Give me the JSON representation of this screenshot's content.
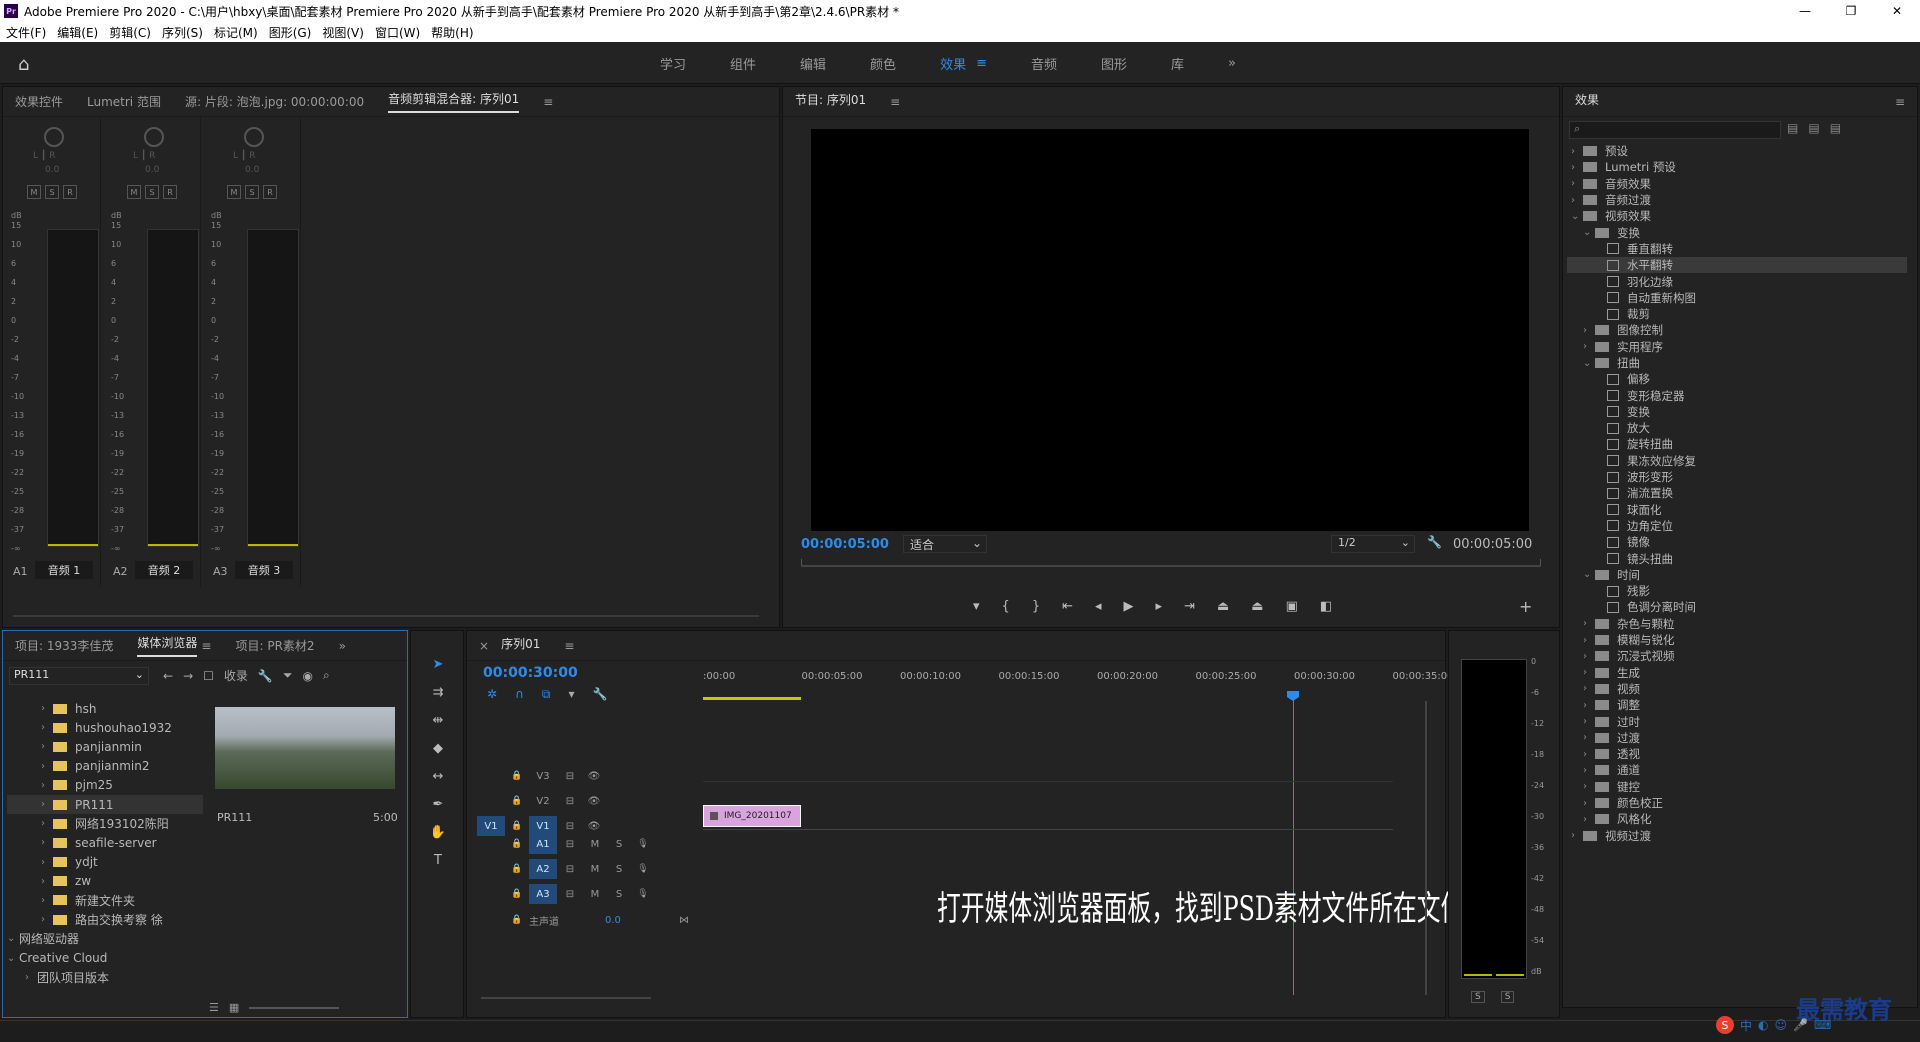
{
  "window": {
    "title": "Adobe Premiere Pro 2020 - C:\\用户\\hbxy\\桌面\\配套素材 Premiere Pro 2020 从新手到高手\\配套素材 Premiere Pro 2020 从新手到高手\\第2章\\2.4.6\\PR素材 *",
    "logo": "Pr"
  },
  "menu": [
    "文件(F)",
    "编辑(E)",
    "剪辑(C)",
    "序列(S)",
    "标记(M)",
    "图形(G)",
    "视图(V)",
    "窗口(W)",
    "帮助(H)"
  ],
  "workspaces": [
    "学习",
    "组件",
    "编辑",
    "颜色",
    "效果",
    "音频",
    "图形",
    "库"
  ],
  "active_workspace": "效果",
  "top_left_tabs": [
    "效果控件",
    "Lumetri 范围",
    "源: 片段: 泡泡.jpg: 00:00:00:00",
    "音频剪辑混合器: 序列01"
  ],
  "mixer": {
    "lr": "L ┃ R",
    "gain": "0.0",
    "db": "dB",
    "scale": [
      "15",
      "10",
      "6",
      "4",
      "2",
      "0",
      "-2",
      "-4",
      "-7",
      "-10",
      "-13",
      "-16",
      "-19",
      "-22",
      "-25",
      "-28",
      "-37",
      "-∞"
    ],
    "channels": [
      {
        "id": "A1",
        "name": "音频 1"
      },
      {
        "id": "A2",
        "name": "音频 2"
      },
      {
        "id": "A3",
        "name": "音频 3"
      }
    ],
    "msr": [
      "M",
      "S",
      "R"
    ]
  },
  "program": {
    "title": "节目: 序列01",
    "timecode": "00:00:05:00",
    "fit": "适合",
    "res": "1/2",
    "duration": "00:00:05:00"
  },
  "project": {
    "tabs": [
      "项目: 1933李佳茂",
      "媒体浏览器",
      "项目: PR素材2"
    ],
    "dropdown": "PR111",
    "ingest": "收录",
    "folders": [
      "hsh",
      "hushouhao1932",
      "panjianmin",
      "panjianmin2",
      "pjm25",
      "PR111",
      "网络193102陈阳",
      "seafile-server",
      "ydjt",
      "zw",
      "新建文件夹",
      "路由交换考察 徐"
    ],
    "network": "网络驱动器",
    "cloud": "Creative Cloud",
    "team": "团队项目版本",
    "clip": {
      "name": "PR111",
      "dur": "5:00"
    }
  },
  "timeline": {
    "title": "序列01",
    "timecode": "00:00:30:00",
    "ruler": [
      ":00:00",
      "00:00:05:00",
      "00:00:10:00",
      "00:00:15:00",
      "00:00:20:00",
      "00:00:25:00",
      "00:00:30:00",
      "00:00:35:00"
    ],
    "vtracks": [
      "V3",
      "V2",
      "V1"
    ],
    "atracks": [
      "A1",
      "A2",
      "A3"
    ],
    "src": "V1",
    "master": "主声道",
    "master_val": "0.0",
    "clip": "IMG_20201107",
    "caption": "打开媒体浏览器面板，找到PSD素材文件所在文件夹"
  },
  "meter_scale": [
    "0",
    "-6",
    "-12",
    "-18",
    "-24",
    "-30",
    "-36",
    "-42",
    "-48",
    "-54",
    "dB"
  ],
  "effects": {
    "title": "效果",
    "items": [
      {
        "t": "预设",
        "l": 0,
        "k": "f",
        "o": false
      },
      {
        "t": "Lumetri 预设",
        "l": 0,
        "k": "f",
        "o": false
      },
      {
        "t": "音频效果",
        "l": 0,
        "k": "f",
        "o": false
      },
      {
        "t": "音频过渡",
        "l": 0,
        "k": "f",
        "o": false
      },
      {
        "t": "视频效果",
        "l": 0,
        "k": "f",
        "o": true
      },
      {
        "t": "变换",
        "l": 1,
        "k": "f",
        "o": true
      },
      {
        "t": "垂直翻转",
        "l": 2,
        "k": "p"
      },
      {
        "t": "水平翻转",
        "l": 2,
        "k": "p",
        "sel": true
      },
      {
        "t": "羽化边缘",
        "l": 2,
        "k": "p"
      },
      {
        "t": "自动重新构图",
        "l": 2,
        "k": "p"
      },
      {
        "t": "裁剪",
        "l": 2,
        "k": "p"
      },
      {
        "t": "图像控制",
        "l": 1,
        "k": "f",
        "o": false
      },
      {
        "t": "实用程序",
        "l": 1,
        "k": "f",
        "o": false
      },
      {
        "t": "扭曲",
        "l": 1,
        "k": "f",
        "o": true
      },
      {
        "t": "偏移",
        "l": 2,
        "k": "p"
      },
      {
        "t": "变形稳定器",
        "l": 2,
        "k": "p"
      },
      {
        "t": "变换",
        "l": 2,
        "k": "p"
      },
      {
        "t": "放大",
        "l": 2,
        "k": "p"
      },
      {
        "t": "旋转扭曲",
        "l": 2,
        "k": "p"
      },
      {
        "t": "果冻效应修复",
        "l": 2,
        "k": "p"
      },
      {
        "t": "波形变形",
        "l": 2,
        "k": "p"
      },
      {
        "t": "湍流置换",
        "l": 2,
        "k": "p"
      },
      {
        "t": "球面化",
        "l": 2,
        "k": "p"
      },
      {
        "t": "边角定位",
        "l": 2,
        "k": "p"
      },
      {
        "t": "镜像",
        "l": 2,
        "k": "p"
      },
      {
        "t": "镜头扭曲",
        "l": 2,
        "k": "p"
      },
      {
        "t": "时间",
        "l": 1,
        "k": "f",
        "o": true
      },
      {
        "t": "残影",
        "l": 2,
        "k": "p"
      },
      {
        "t": "色调分离时间",
        "l": 2,
        "k": "p"
      },
      {
        "t": "杂色与颗粒",
        "l": 1,
        "k": "f",
        "o": false
      },
      {
        "t": "模糊与锐化",
        "l": 1,
        "k": "f",
        "o": false
      },
      {
        "t": "沉浸式视频",
        "l": 1,
        "k": "f",
        "o": false
      },
      {
        "t": "生成",
        "l": 1,
        "k": "f",
        "o": false
      },
      {
        "t": "视频",
        "l": 1,
        "k": "f",
        "o": false
      },
      {
        "t": "调整",
        "l": 1,
        "k": "f",
        "o": false
      },
      {
        "t": "过时",
        "l": 1,
        "k": "f",
        "o": false
      },
      {
        "t": "过渡",
        "l": 1,
        "k": "f",
        "o": false
      },
      {
        "t": "透视",
        "l": 1,
        "k": "f",
        "o": false
      },
      {
        "t": "通道",
        "l": 1,
        "k": "f",
        "o": false
      },
      {
        "t": "键控",
        "l": 1,
        "k": "f",
        "o": false
      },
      {
        "t": "颜色校正",
        "l": 1,
        "k": "f",
        "o": false
      },
      {
        "t": "风格化",
        "l": 1,
        "k": "f",
        "o": false
      },
      {
        "t": "视频过渡",
        "l": 0,
        "k": "f",
        "o": false
      }
    ]
  },
  "watermark": "最需教育",
  "ime": "中"
}
